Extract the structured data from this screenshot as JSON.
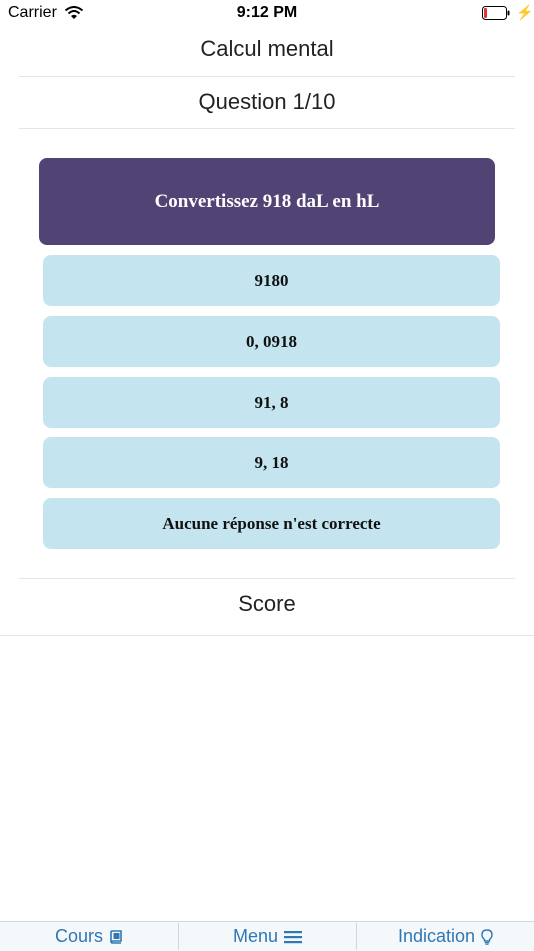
{
  "status_bar": {
    "carrier": "Carrier",
    "time": "9:12 PM"
  },
  "app_title": "Calcul mental",
  "question_label": "Question 1/10",
  "question": "Convertissez 918 daL en hL",
  "answers": [
    "9180",
    "0, 0918",
    "91, 8",
    "9, 18",
    "Aucune réponse n'est correcte"
  ],
  "score_label": "Score",
  "tabbar": {
    "tabs": [
      {
        "label": "Cours",
        "icon": "book-icon"
      },
      {
        "label": "Menu",
        "icon": "list-icon"
      },
      {
        "label": "Indication",
        "icon": "lightbulb-icon"
      }
    ]
  },
  "colors": {
    "question_bg": "#514474",
    "answer_bg": "#c4e5f0",
    "tab_text": "#2f78b5",
    "battery_low": "#e0342f"
  }
}
